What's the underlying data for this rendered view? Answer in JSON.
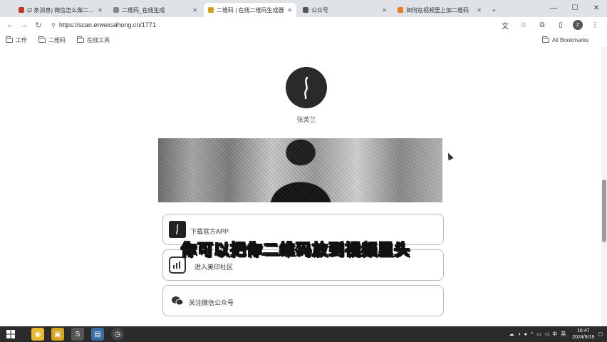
{
  "tabs": [
    {
      "title": "(2 条消息) 微信怎么做二维码",
      "color": "#c0392b",
      "active": false
    },
    {
      "title": "二维码_在线生成",
      "color": "#7f8c8d",
      "active": false
    },
    {
      "title": "二维码 | 在线二维码生成器",
      "color": "#d4a017",
      "active": true
    },
    {
      "title": "公众号",
      "color": "#555555",
      "active": false
    },
    {
      "title": "如何在视频里上加二维码",
      "color": "#e67e22",
      "active": false
    },
    {
      "title": "",
      "color": "#bbbbbb",
      "active": false
    }
  ],
  "toolbar": {
    "url": "https://scan.erweicaihong.cn/1771"
  },
  "bookmarks": {
    "items": [
      "工作",
      "二维码",
      "在线工具"
    ],
    "all": "All Bookmarks"
  },
  "profile": {
    "name": "张芙兰"
  },
  "cards": [
    {
      "label": "下载官方APP",
      "icon": "app-icon"
    },
    {
      "label": "进入美印社区",
      "icon": "community-icon"
    },
    {
      "label": "关注微信公众号",
      "icon": "wechat-icon"
    }
  ],
  "subtitle": "你可以把你二维码放到视频里头",
  "taskbar": {
    "time": "16:47",
    "date": "2024/9/19",
    "ime": "中",
    "lang": "英"
  },
  "colors": {
    "subtitle_fill": "#f7e34c",
    "taskbar": "#2b2b2b"
  }
}
